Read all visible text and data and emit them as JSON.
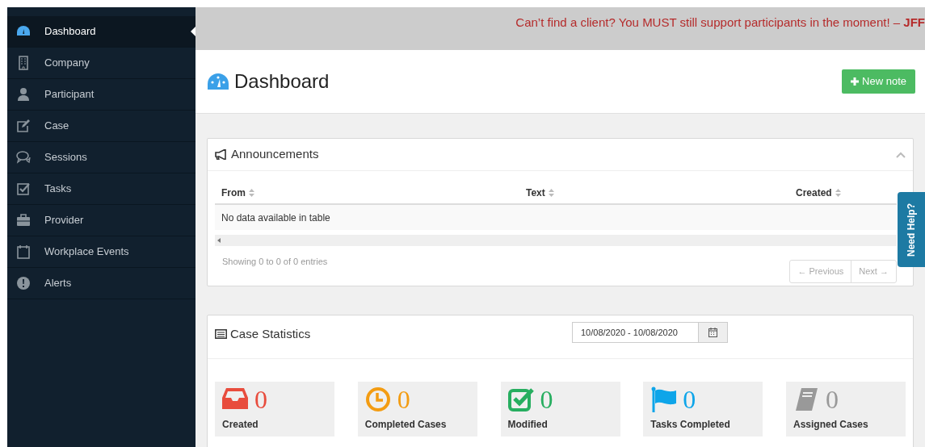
{
  "sidebar": {
    "items": [
      {
        "label": "Dashboard",
        "selected": true
      },
      {
        "label": "Company",
        "selected": false
      },
      {
        "label": "Participant",
        "selected": false
      },
      {
        "label": "Case",
        "selected": false
      },
      {
        "label": "Sessions",
        "selected": false
      },
      {
        "label": "Tasks",
        "selected": false
      },
      {
        "label": "Provider",
        "selected": false
      },
      {
        "label": "Workplace Events",
        "selected": false
      },
      {
        "label": "Alerts",
        "selected": false
      }
    ]
  },
  "banner": {
    "text": "Can’t find a client? You MUST still support participants in the moment! – **JFF**"
  },
  "page": {
    "title": "Dashboard",
    "new_button": "New note"
  },
  "announcements": {
    "title": "Announcements",
    "columns": [
      "From",
      "Text",
      "Created"
    ],
    "empty_message": "No data available in table",
    "info": "Showing 0 to 0 of 0 entries",
    "pager": [
      "← Previous",
      "Next →"
    ]
  },
  "help_tab": "Need Help?",
  "case_statistics": {
    "title": "Case Statistics",
    "date_range": "10/08/2020 - 10/08/2020",
    "stats": [
      {
        "color": "#e84c3d",
        "value": "0",
        "label": "Created"
      },
      {
        "color": "#f39c12",
        "value": "0",
        "label": "Completed Cases"
      },
      {
        "color": "#27ae60",
        "value": "0",
        "label": "Modified"
      },
      {
        "color": "#0ea5e9",
        "value": "0",
        "label": "Tasks Completed"
      },
      {
        "color": "#999999",
        "value": "0",
        "label": "Assigned Cases"
      }
    ]
  }
}
